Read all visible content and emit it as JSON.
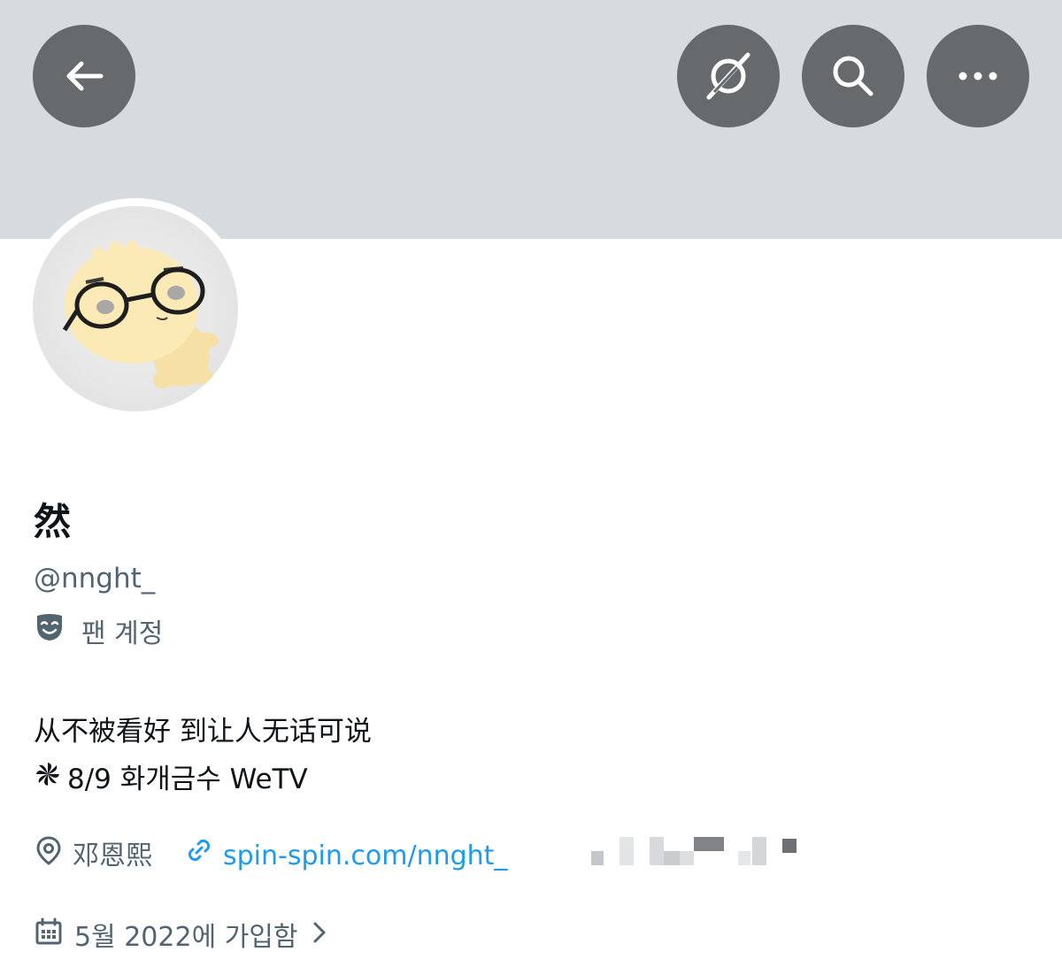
{
  "header": {
    "back_icon": "arrow-left-icon",
    "grok_icon": "grok-icon",
    "search_icon": "search-icon",
    "more_icon": "more-horizontal-icon",
    "banner_color": "#d5dbdf",
    "button_color": "#666a6d"
  },
  "profile": {
    "display_name": "然",
    "handle": "@nnght_",
    "label_icon": "mask-icon",
    "label": "팬 계정",
    "bio_line1": "从不被看好 到让人无话可说",
    "bio_line2_icon": "pinwheel-icon",
    "bio_line2": "8/9 화개금수 WeTV",
    "location_icon": "location-pin-icon",
    "location": "邓恩熙",
    "link_icon": "link-icon",
    "link": "spin-spin.com/nnght_",
    "joined_icon": "calendar-icon",
    "joined": "5월 2022에 가입함",
    "joined_chevron": "chevron-right-icon"
  },
  "colors": {
    "link": "#1d9bf0",
    "secondary_text": "#536471",
    "primary_text": "#0f1419"
  }
}
